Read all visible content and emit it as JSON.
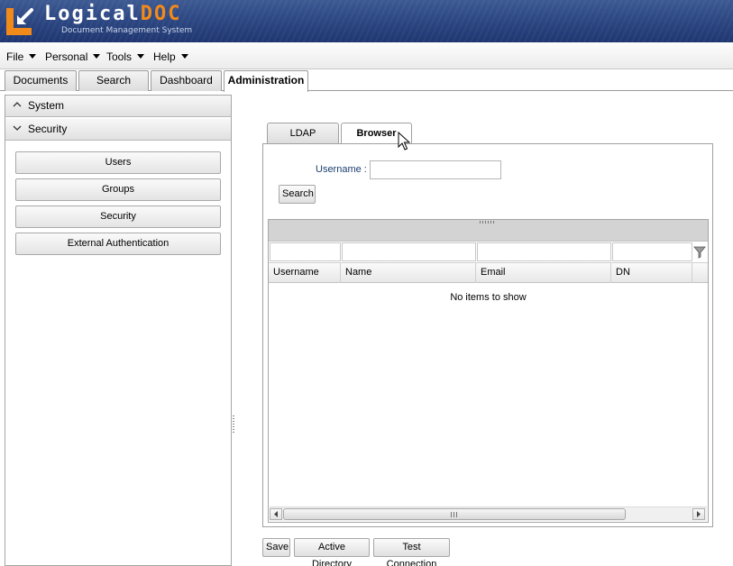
{
  "header": {
    "logo_main": "Logical",
    "logo_accent": "DOC",
    "subtitle": "Document Management System",
    "accent_color": "#f28a1a"
  },
  "menubar": {
    "items": [
      {
        "label": "File"
      },
      {
        "label": "Personal"
      },
      {
        "label": "Tools"
      },
      {
        "label": "Help"
      }
    ]
  },
  "main_tabs": [
    {
      "label": "Documents"
    },
    {
      "label": "Search"
    },
    {
      "label": "Dashboard"
    },
    {
      "label": "Administration",
      "active": true
    }
  ],
  "sidebar": {
    "sections": [
      {
        "label": "System",
        "expanded": false
      },
      {
        "label": "Security",
        "expanded": true
      }
    ],
    "buttons": [
      {
        "label": "Users"
      },
      {
        "label": "Groups"
      },
      {
        "label": "Security"
      },
      {
        "label": "External Authentication"
      }
    ]
  },
  "inner_tabs": [
    {
      "label": "LDAP"
    },
    {
      "label": "Browser",
      "active": true
    }
  ],
  "browser": {
    "username_label": "Username :",
    "username_value": "",
    "search_label": "Search",
    "columns": [
      "Username",
      "Name",
      "Email",
      "DN"
    ],
    "empty_message": "No items to show"
  },
  "footer_buttons": {
    "save": "Save",
    "active_directory": "Active Directory",
    "test_connection": "Test Connection"
  }
}
